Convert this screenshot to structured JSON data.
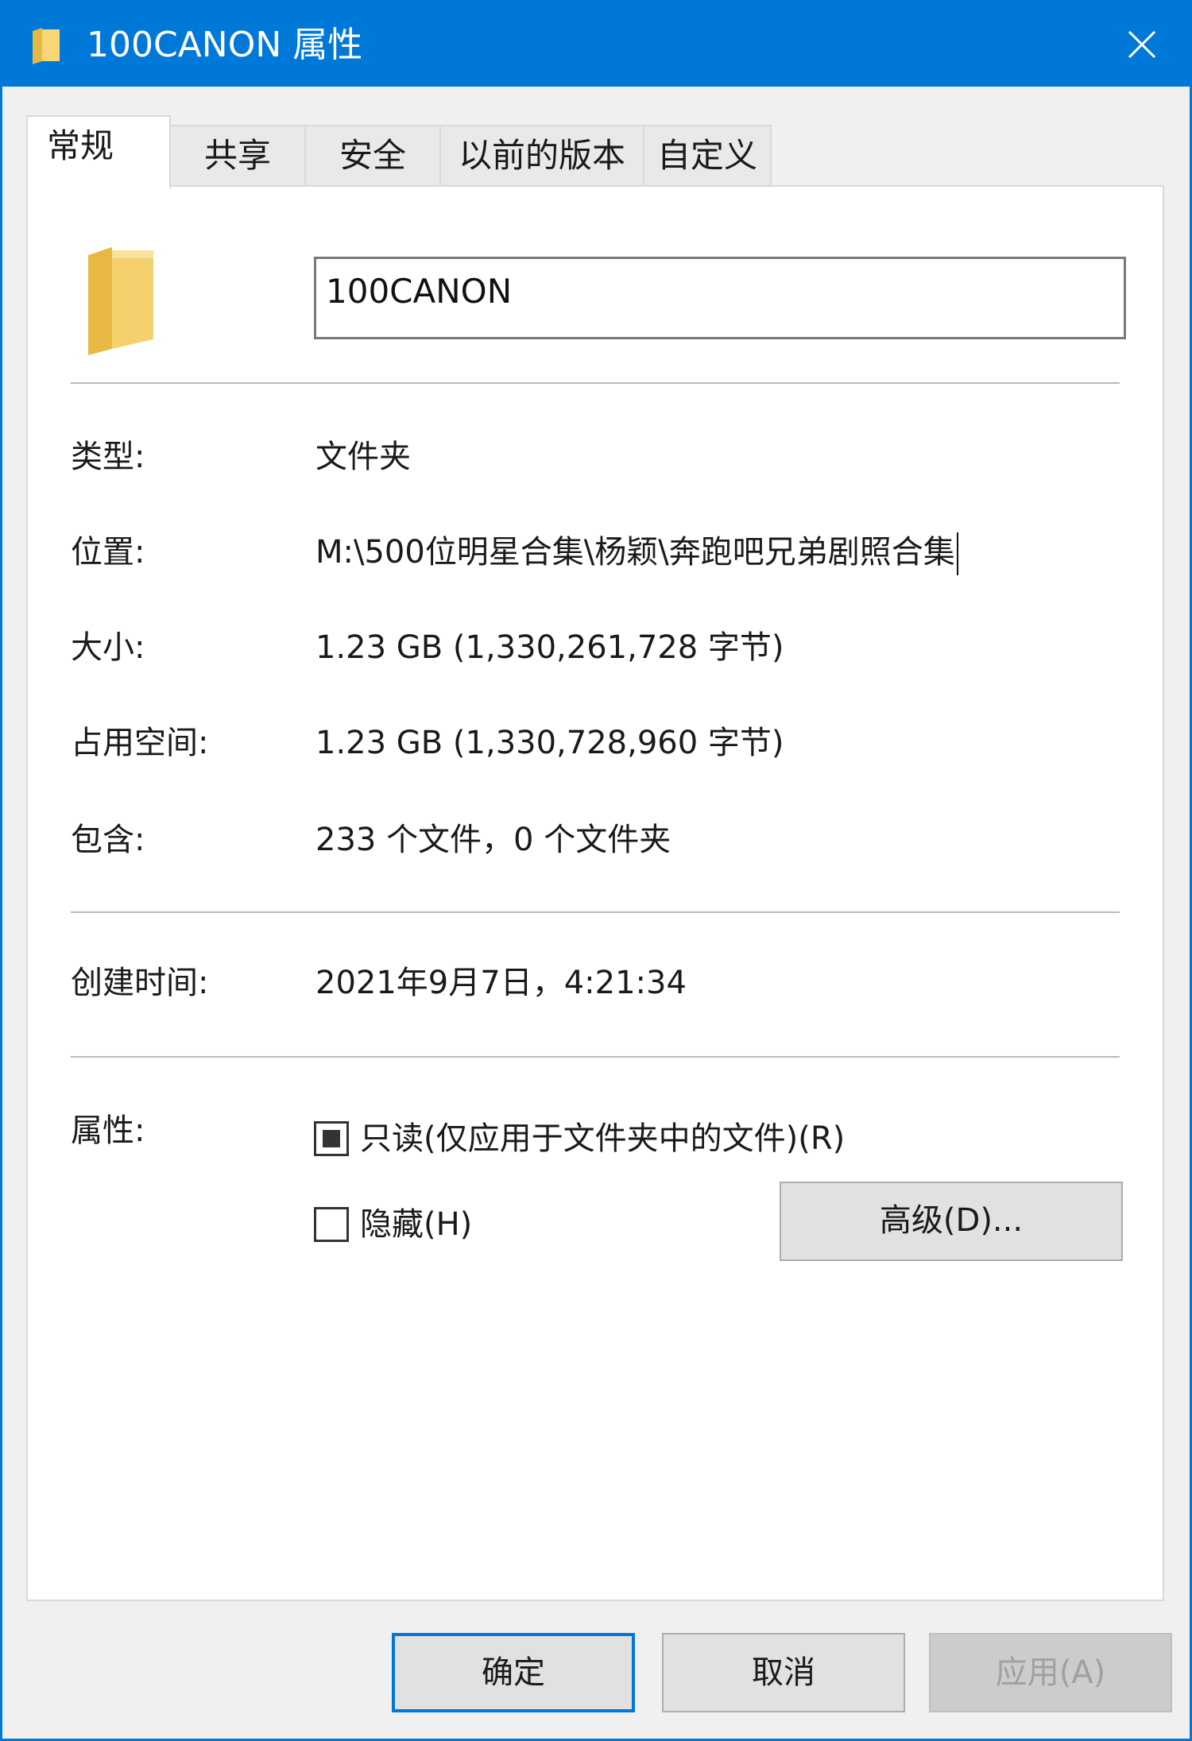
{
  "window": {
    "title": "100CANON 属性",
    "accent_color": "#0078d7",
    "close_icon": "close-icon"
  },
  "tabs": [
    {
      "label": "常规",
      "active": true
    },
    {
      "label": "共享",
      "active": false
    },
    {
      "label": "安全",
      "active": false
    },
    {
      "label": "以前的版本",
      "active": false
    },
    {
      "label": "自定义",
      "active": false
    }
  ],
  "general": {
    "folder_icon": "folder-icon",
    "name_value": "100CANON",
    "type_label": "类型:",
    "type_value": "文件夹",
    "location_label": "位置:",
    "location_value": "M:\\500位明星合集\\杨颖\\奔跑吧兄弟剧照合集",
    "size_label": "大小:",
    "size_value": "1.23 GB (1,330,261,728 字节)",
    "size_on_disk_label": "占用空间:",
    "size_on_disk_value": "1.23 GB (1,330,728,960 字节)",
    "contains_label": "包含:",
    "contains_value": "233 个文件，0 个文件夹",
    "created_label": "创建时间:",
    "created_value": "2021年9月7日，4:21:34",
    "attributes_label": "属性:",
    "readonly_label": "只读(仅应用于文件夹中的文件)(R)",
    "readonly_state": "indeterminate",
    "hidden_label": "隐藏(H)",
    "hidden_checked": false,
    "advanced_button": "高级(D)..."
  },
  "footer": {
    "ok_label": "确定",
    "cancel_label": "取消",
    "apply_label": "应用(A)",
    "apply_enabled": false
  }
}
